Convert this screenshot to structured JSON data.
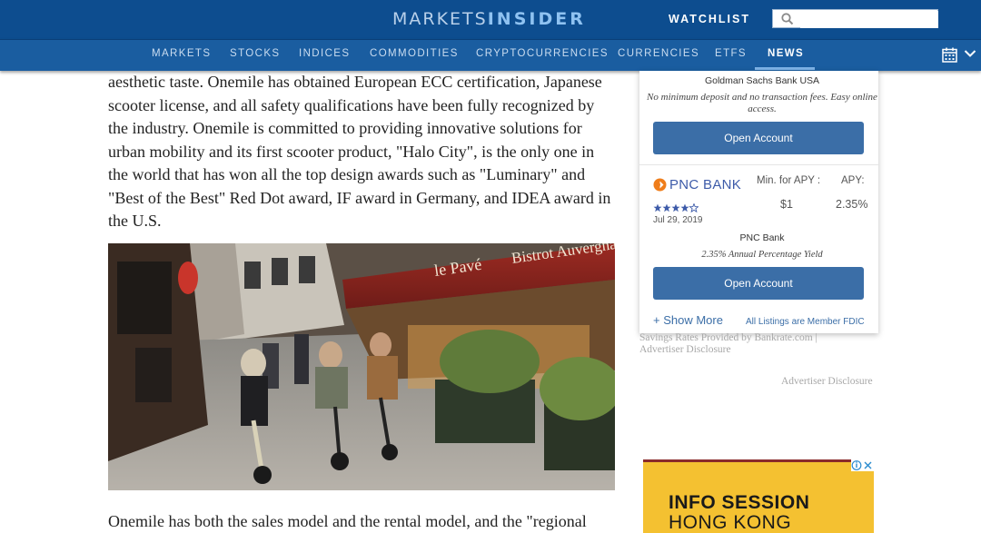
{
  "header": {
    "logo_left": "MARKETS",
    "logo_right": "INSIDER",
    "watchlist_label": "WATCHLIST",
    "search_placeholder": "",
    "colors": {
      "topbar": "#0d4d8f",
      "navbar": "#1a5da0"
    }
  },
  "nav": {
    "items": [
      {
        "label": "MARKETS"
      },
      {
        "label": "STOCKS"
      },
      {
        "label": "INDICES"
      },
      {
        "label": "COMMODITIES"
      },
      {
        "label": "CRYPTOCURRENCIES"
      },
      {
        "label": "CURRENCIES"
      },
      {
        "label": "ETFS"
      },
      {
        "label": "NEWS",
        "active": true
      }
    ],
    "icons": [
      "calendar-icon",
      "chevron-down-icon"
    ]
  },
  "article": {
    "paragraph_1": "aesthetic taste. Onemile has obtained European ECC certification, Japanese scooter license, and all safety qualifications have been fully recognized by the industry. Onemile is committed to providing innovative solutions for urban mobility and its first scooter product, \"Halo City\", is the only one in the world that has won all the top design awards such as \"Luminary\" and \"Best of the Best\" Red Dot award, IF award in Germany, and IDEA award in the U.S.",
    "photo_signs": {
      "left": "le Pavé",
      "right": "Bistrot Auvergnat"
    },
    "paragraph_2_start": "Onemile has both the sales model and the rental model, and the \"regional"
  },
  "rates_widget": {
    "goldman": {
      "bank_name": "Goldman Sachs Bank USA",
      "description": "No minimum deposit and no transaction fees. Easy online access.",
      "button": "Open Account"
    },
    "pnc": {
      "logo_text": "PNC BANK",
      "rating": 4,
      "rating_max": 5,
      "date": "Jul 29, 2019",
      "min_label": "Min. for APY :",
      "min_value": "$1",
      "apy_label": "APY:",
      "apy_value": "2.35%",
      "bank_name": "PNC Bank",
      "yield_text": "2.35% Annual Percentage Yield",
      "button": "Open Account"
    },
    "show_more": "+ Show More",
    "fdic": "All Listings are Member FDIC"
  },
  "sidebar": {
    "rates_note": "Savings Rates Provided by Bankrate.com | Advertiser Disclosure",
    "advertiser_disclosure": "Advertiser Disclosure"
  },
  "ad": {
    "line1": "INFO SESSION",
    "line2": "HONG KONG",
    "bg_color": "#f4c131"
  }
}
